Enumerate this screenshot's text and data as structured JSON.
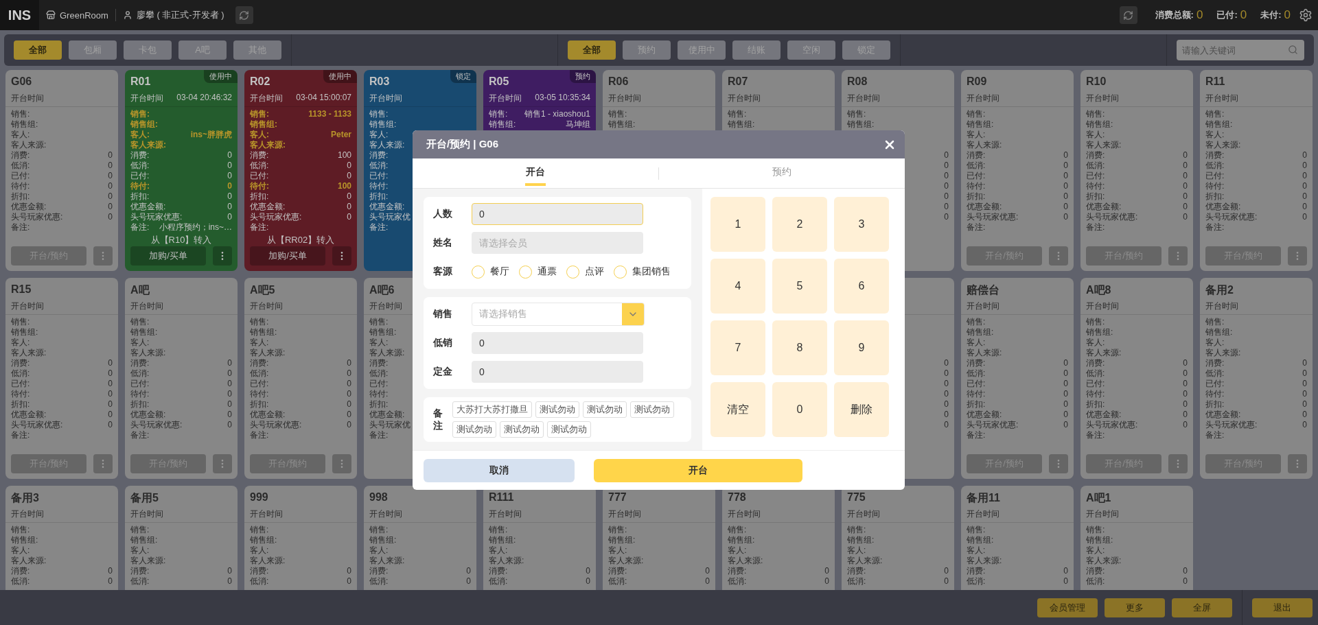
{
  "top_bar": {
    "logo": "INS",
    "store": "GreenRoom",
    "user": "廖攀 ( 非正式-开发者 )",
    "summary": [
      {
        "label": "消费总额:",
        "value": "0"
      },
      {
        "label": "已付:",
        "value": "0"
      },
      {
        "label": "未付:",
        "value": "0"
      }
    ]
  },
  "area_filters": [
    {
      "label": "全部",
      "selected": true
    },
    {
      "label": "包厢",
      "selected": false
    },
    {
      "label": "卡包",
      "selected": false
    },
    {
      "label": "A吧",
      "selected": false
    },
    {
      "label": "其他",
      "selected": false
    }
  ],
  "status_filters": [
    {
      "label": "全部",
      "selected": true
    },
    {
      "label": "预约",
      "selected": false
    },
    {
      "label": "使用中",
      "selected": false
    },
    {
      "label": "结账",
      "selected": false
    },
    {
      "label": "空闲",
      "selected": false
    },
    {
      "label": "锁定",
      "selected": false
    }
  ],
  "search": {
    "placeholder": "请输入关键词"
  },
  "card_rows": [
    {
      "cards": [
        {
          "name": "G06",
          "color": "#878787",
          "open_label": "开台时间",
          "rows": [
            {
              "label": "销售:"
            },
            {
              "label": "销售组:"
            },
            {
              "label": "客人:"
            },
            {
              "label": "客人来源:"
            },
            {
              "label": "消费:",
              "value": "0"
            },
            {
              "label": "低消:",
              "value": "0"
            },
            {
              "label": "已付:",
              "value": "0"
            },
            {
              "label": "待付:",
              "value": "0"
            },
            {
              "label": "折扣:",
              "value": "0"
            },
            {
              "label": "优惠金额:",
              "value": "0"
            },
            {
              "label": "头号玩家优惠:",
              "value": "0"
            },
            {
              "label": "备注:"
            }
          ],
          "action": "开台/预约"
        },
        {
          "name": "R01",
          "badge": "使用中",
          "color": "#245c2d",
          "open_label": "开台时间",
          "open_time": "03-04 20:46:32",
          "rows": [
            {
              "label": "销售:",
              "highlight": true
            },
            {
              "label": "销售组:",
              "highlight": true
            },
            {
              "label": "客人:",
              "value": "ins~胖胖虎",
              "highlight": true
            },
            {
              "label": "客人来源:",
              "highlight": true
            },
            {
              "label": "消费:",
              "value": "0",
              "highlight": false
            },
            {
              "label": "低消:",
              "value": "0",
              "highlight": false
            },
            {
              "label": "已付:",
              "value": "0",
              "highlight": false
            },
            {
              "label": "待付:",
              "value": "0",
              "highlight": true
            },
            {
              "label": "折扣:",
              "value": "0",
              "highlight": false
            },
            {
              "label": "优惠金额:",
              "value": "0",
              "highlight": false
            },
            {
              "label": "头号玩家优惠:",
              "value": "0",
              "highlight": false
            },
            {
              "label": "备注:",
              "value": "小程序预约；ins~…",
              "highlight": false
            }
          ],
          "transfer": "从【R10】转入",
          "action": "加购/买单"
        },
        {
          "name": "R02",
          "badge": "使用中",
          "color": "#5e1c25",
          "open_label": "开台时间",
          "open_time": "03-04 15:00:07",
          "rows": [
            {
              "label": "销售:",
              "value": "1133 - 1133",
              "highlight": true
            },
            {
              "label": "销售组:",
              "highlight": true
            },
            {
              "label": "客人:",
              "value": "Peter",
              "highlight": true
            },
            {
              "label": "客人来源:",
              "highlight": true
            },
            {
              "label": "消费:",
              "value": "100",
              "highlight": false
            },
            {
              "label": "低消:",
              "value": "0",
              "highlight": false
            },
            {
              "label": "已付:",
              "value": "0",
              "highlight": false
            },
            {
              "label": "待付:",
              "value": "100",
              "highlight": true
            },
            {
              "label": "折扣:",
              "value": "0",
              "highlight": false
            },
            {
              "label": "优惠金额:",
              "value": "0",
              "highlight": false
            },
            {
              "label": "头号玩家优惠:",
              "value": "0",
              "highlight": false
            },
            {
              "label": "备注:",
              "highlight": false
            }
          ],
          "transfer": "从【RR02】转入",
          "action": "加购/买单"
        },
        {
          "name": "R03",
          "badge": "锁定",
          "color": "#184a70",
          "open_label": "开台时间",
          "rows": [
            {
              "label": "销售:"
            },
            {
              "label": "销售组:"
            },
            {
              "label": "客人:"
            },
            {
              "label": "客人来源:"
            },
            {
              "label": "消费:"
            },
            {
              "label": "低消:"
            },
            {
              "label": "已付:"
            },
            {
              "label": "待付:"
            },
            {
              "label": "折扣:"
            },
            {
              "label": "优惠金额:"
            },
            {
              "label": "头号玩家优"
            },
            {
              "label": "备注:"
            }
          ]
        },
        {
          "name": "R05",
          "badge": "预约",
          "color": "#3f1d62",
          "open_label": "开台时间",
          "open_time": "03-05 10:35:34",
          "rows": [
            {
              "label": "销售:",
              "value": "销售1 - xiaoshou1"
            },
            {
              "label": "销售组:",
              "value": "马坤组"
            }
          ]
        },
        {
          "name": "R06",
          "color": "#878787",
          "open_label": "开台时间",
          "rows": [
            {
              "label": "销售:"
            },
            {
              "label": "销售组:"
            }
          ]
        },
        {
          "name": "R07",
          "color": "#878787",
          "open_label": "开台时间",
          "rows": [
            {
              "label": "销售:"
            },
            {
              "label": "销售组:"
            }
          ]
        },
        {
          "name": "R08",
          "color": "#878787",
          "open_label": "开台时间",
          "rows": [
            {
              "label": "销售:"
            },
            {
              "label": "销售组:"
            },
            {},
            {},
            {
              "value": "0"
            },
            {
              "value": "0"
            },
            {
              "value": "0"
            },
            {
              "value": "0"
            },
            {
              "value": "0"
            },
            {
              "value": "0"
            },
            {
              "value": "0"
            },
            {}
          ]
        },
        {
          "name": "R09",
          "color": "#878787",
          "open_label": "开台时间",
          "rows": [
            {
              "label": "销售:"
            },
            {
              "label": "销售组:"
            },
            {
              "label": "客人:"
            },
            {
              "label": "客人来源:"
            },
            {
              "label": "消费:",
              "value": "0"
            },
            {
              "label": "低消:",
              "value": "0"
            },
            {
              "label": "已付:",
              "value": "0"
            },
            {
              "label": "待付:",
              "value": "0"
            },
            {
              "label": "折扣:",
              "value": "0"
            },
            {
              "label": "优惠金额:",
              "value": "0"
            },
            {
              "label": "头号玩家优惠:",
              "value": "0"
            },
            {
              "label": "备注:"
            }
          ],
          "action": "开台/预约"
        },
        {
          "name": "R10",
          "color": "#878787",
          "open_label": "开台时间",
          "rows": [
            {
              "label": "销售:"
            },
            {
              "label": "销售组:"
            },
            {
              "label": "客人:"
            },
            {
              "label": "客人来源:"
            },
            {
              "label": "消费:",
              "value": "0"
            },
            {
              "label": "低消:",
              "value": "0"
            },
            {
              "label": "已付:",
              "value": "0"
            },
            {
              "label": "待付:",
              "value": "0"
            },
            {
              "label": "折扣:",
              "value": "0"
            },
            {
              "label": "优惠金额:",
              "value": "0"
            },
            {
              "label": "头号玩家优惠:",
              "value": "0"
            },
            {
              "label": "备注:"
            }
          ],
          "action": "开台/预约"
        },
        {
          "name": "R11",
          "color": "#878787",
          "open_label": "开台时间",
          "rows": [
            {
              "label": "销售:"
            },
            {
              "label": "销售组:"
            },
            {
              "label": "客人:"
            },
            {
              "label": "客人来源:"
            },
            {
              "label": "消费:",
              "value": "0"
            },
            {
              "label": "低消:",
              "value": "0"
            },
            {
              "label": "已付:",
              "value": "0"
            },
            {
              "label": "待付:",
              "value": "0"
            },
            {
              "label": "折扣:",
              "value": "0"
            },
            {
              "label": "优惠金额:",
              "value": "0"
            },
            {
              "label": "头号玩家优惠:",
              "value": "0"
            },
            {
              "label": "备注:"
            }
          ],
          "action": "开台/预约"
        }
      ]
    },
    {
      "cards": [
        {
          "name": "R15",
          "color": "#878787",
          "open_label": "开台时间",
          "rows": [
            {
              "label": "销售:"
            },
            {
              "label": "销售组:"
            },
            {
              "label": "客人:"
            },
            {
              "label": "客人来源:"
            },
            {
              "label": "消费:",
              "value": "0"
            },
            {
              "label": "低消:",
              "value": "0"
            },
            {
              "label": "已付:",
              "value": "0"
            },
            {
              "label": "待付:",
              "value": "0"
            },
            {
              "label": "折扣:",
              "value": "0"
            },
            {
              "label": "优惠金额:",
              "value": "0"
            },
            {
              "label": "头号玩家优惠:",
              "value": "0"
            },
            {
              "label": "备注:"
            }
          ],
          "action": "开台/预约"
        },
        {
          "name": "A吧",
          "color": "#878787",
          "open_label": "开台时间",
          "rows": [
            {
              "label": "销售:"
            },
            {
              "label": "销售组:"
            },
            {
              "label": "客人:"
            },
            {
              "label": "客人来源:"
            },
            {
              "label": "消费:",
              "value": "0"
            },
            {
              "label": "低消:",
              "value": "0"
            },
            {
              "label": "已付:",
              "value": "0"
            },
            {
              "label": "待付:",
              "value": "0"
            },
            {
              "label": "折扣:",
              "value": "0"
            },
            {
              "label": "优惠金额:",
              "value": "0"
            },
            {
              "label": "头号玩家优惠:",
              "value": "0"
            },
            {
              "label": "备注:"
            }
          ],
          "action": "开台/预约"
        },
        {
          "name": "A吧5",
          "color": "#878787",
          "open_label": "开台时间",
          "rows": [
            {
              "label": "销售:"
            },
            {
              "label": "销售组:"
            },
            {
              "label": "客人:"
            },
            {
              "label": "客人来源:"
            },
            {
              "label": "消费:",
              "value": "0"
            },
            {
              "label": "低消:",
              "value": "0"
            },
            {
              "label": "已付:",
              "value": "0"
            },
            {
              "label": "待付:",
              "value": "0"
            },
            {
              "label": "折扣:",
              "value": "0"
            },
            {
              "label": "优惠金额:",
              "value": "0"
            },
            {
              "label": "头号玩家优惠:",
              "value": "0"
            },
            {
              "label": "备注:"
            }
          ],
          "action": "开台/预约"
        },
        {
          "name": "A吧6",
          "color": "#878787",
          "open_label": "开台时间",
          "rows": [
            {
              "label": "销售:"
            },
            {
              "label": "销售组:"
            },
            {
              "label": "客人:"
            },
            {
              "label": "客人来源:"
            },
            {
              "label": "消费:"
            },
            {
              "label": "低消:"
            },
            {
              "label": "已付:"
            },
            {
              "label": "待付:"
            },
            {
              "label": "折扣:"
            },
            {
              "label": "优惠金额:"
            },
            {
              "label": "头号玩家优"
            },
            {
              "label": "备注:"
            }
          ]
        }
      ],
      "right": [
        {
          "rows": [
            {},
            {},
            {},
            {},
            {
              "value": "0"
            },
            {
              "value": "0"
            },
            {
              "value": "0"
            },
            {
              "value": "0"
            },
            {
              "value": "0"
            },
            {
              "value": "0"
            },
            {
              "value": "0"
            },
            {}
          ]
        },
        {
          "name": "赔偿台",
          "color": "#878787",
          "open_label": "开台时间",
          "rows": [
            {
              "label": "销售:"
            },
            {
              "label": "销售组:"
            },
            {
              "label": "客人:"
            },
            {
              "label": "客人来源:"
            },
            {
              "label": "消费:",
              "value": "0"
            },
            {
              "label": "低消:",
              "value": "0"
            },
            {
              "label": "已付:",
              "value": "0"
            },
            {
              "label": "待付:",
              "value": "0"
            },
            {
              "label": "折扣:",
              "value": "0"
            },
            {
              "label": "优惠金额:",
              "value": "0"
            },
            {
              "label": "头号玩家优惠:",
              "value": "0"
            },
            {
              "label": "备注:"
            }
          ],
          "action": "开台/预约"
        },
        {
          "name": "A吧8",
          "color": "#878787",
          "open_label": "开台时间",
          "rows": [
            {
              "label": "销售:"
            },
            {
              "label": "销售组:"
            },
            {
              "label": "客人:"
            },
            {
              "label": "客人来源:"
            },
            {
              "label": "消费:",
              "value": "0"
            },
            {
              "label": "低消:",
              "value": "0"
            },
            {
              "label": "已付:",
              "value": "0"
            },
            {
              "label": "待付:",
              "value": "0"
            },
            {
              "label": "折扣:",
              "value": "0"
            },
            {
              "label": "优惠金额:",
              "value": "0"
            },
            {
              "label": "头号玩家优惠:",
              "value": "0"
            },
            {
              "label": "备注:"
            }
          ],
          "action": "开台/预约"
        },
        {
          "name": "备用2",
          "color": "#878787",
          "open_label": "开台时间",
          "rows": [
            {
              "label": "销售:"
            },
            {
              "label": "销售组:"
            },
            {
              "label": "客人:"
            },
            {
              "label": "客人来源:"
            },
            {
              "label": "消费:",
              "value": "0"
            },
            {
              "label": "低消:",
              "value": "0"
            },
            {
              "label": "已付:",
              "value": "0"
            },
            {
              "label": "待付:",
              "value": "0"
            },
            {
              "label": "折扣:",
              "value": "0"
            },
            {
              "label": "优惠金额:",
              "value": "0"
            },
            {
              "label": "头号玩家优惠:",
              "value": "0"
            },
            {
              "label": "备注:"
            }
          ],
          "action": "开台/预约"
        }
      ]
    },
    {
      "cards": [
        {
          "name": "备用3",
          "color": "#878787",
          "open_label": "开台时间",
          "rows": [
            {
              "label": "销售:"
            },
            {
              "label": "销售组:"
            },
            {
              "label": "客人:"
            },
            {
              "label": "客人来源:"
            },
            {
              "label": "消费:",
              "value": "0"
            },
            {
              "label": "低消:",
              "value": "0"
            }
          ]
        },
        {
          "name": "备用5",
          "color": "#878787",
          "open_label": "开台时间",
          "rows": [
            {
              "label": "销售:"
            },
            {
              "label": "销售组:"
            },
            {
              "label": "客人:"
            },
            {
              "label": "客人来源:"
            },
            {
              "label": "消费:",
              "value": "0"
            },
            {
              "label": "低消:",
              "value": "0"
            }
          ]
        },
        {
          "name": "999",
          "color": "#878787",
          "open_label": "开台时间",
          "rows": [
            {
              "label": "销售:"
            },
            {
              "label": "销售组:"
            },
            {
              "label": "客人:"
            },
            {
              "label": "客人来源:"
            },
            {
              "label": "消费:",
              "value": "0"
            },
            {
              "label": "低消:",
              "value": "0"
            }
          ]
        },
        {
          "name": "998",
          "color": "#878787",
          "open_label": "开台时间",
          "rows": [
            {
              "label": "销售:"
            },
            {
              "label": "销售组:"
            },
            {
              "label": "客人:"
            },
            {
              "label": "客人来源:"
            },
            {
              "label": "消费:",
              "value": "0"
            },
            {
              "label": "低消:",
              "value": "0"
            }
          ]
        },
        {
          "name": "R111",
          "color": "#878787",
          "open_label": "开台时间",
          "rows": [
            {
              "label": "销售:"
            },
            {
              "label": "销售组:"
            },
            {
              "label": "客人:"
            },
            {
              "label": "客人来源:"
            },
            {
              "label": "消费:",
              "value": "0"
            },
            {
              "label": "低消:",
              "value": "0"
            }
          ]
        },
        {
          "name": "777",
          "color": "#878787",
          "open_label": "开台时间",
          "rows": [
            {
              "label": "销售:"
            },
            {
              "label": "销售组:"
            },
            {
              "label": "客人:"
            },
            {
              "label": "客人来源:"
            },
            {
              "label": "消费:",
              "value": "0"
            },
            {
              "label": "低消:",
              "value": "0"
            }
          ]
        },
        {
          "name": "778",
          "color": "#878787",
          "open_label": "开台时间",
          "rows": [
            {
              "label": "销售:"
            },
            {
              "label": "销售组:"
            },
            {
              "label": "客人:"
            },
            {
              "label": "客人来源:"
            },
            {
              "label": "消费:",
              "value": "0"
            },
            {
              "label": "低消:",
              "value": "0"
            }
          ]
        },
        {
          "name": "775",
          "color": "#878787",
          "open_label": "开台时间",
          "rows": [
            {
              "label": "销售:"
            },
            {
              "label": "销售组:"
            },
            {
              "label": "客人:"
            },
            {
              "label": "客人来源:"
            },
            {
              "label": "消费:",
              "value": "0"
            },
            {
              "label": "低消:",
              "value": "0"
            }
          ]
        },
        {
          "name": "备用11",
          "color": "#878787",
          "open_label": "开台时间",
          "rows": [
            {
              "label": "销售:"
            },
            {
              "label": "销售组:"
            },
            {
              "label": "客人:"
            },
            {
              "label": "客人来源:"
            },
            {
              "label": "消费:",
              "value": "0"
            },
            {
              "label": "低消:",
              "value": "0"
            }
          ]
        },
        {
          "name": "A吧1",
          "color": "#878787",
          "open_label": "开台时间",
          "rows": [
            {
              "label": "销售:"
            },
            {
              "label": "销售组:"
            },
            {
              "label": "客人:"
            },
            {
              "label": "客人来源:"
            },
            {
              "label": "消费:",
              "value": "0"
            },
            {
              "label": "低消:",
              "value": "0"
            }
          ]
        }
      ]
    }
  ],
  "modal": {
    "title": "开台/预约 | G06",
    "tabs": [
      {
        "label": "开台",
        "selected": true
      },
      {
        "label": "预约",
        "selected": false
      }
    ],
    "sections": [
      {
        "fields": [
          {
            "kind": "input",
            "label": "人数",
            "value": "0",
            "focused": true
          },
          {
            "kind": "input",
            "label": "姓名",
            "placeholder": "请选择会员",
            "focused": false
          },
          {
            "kind": "radio",
            "label": "客源",
            "options": [
              {
                "label": "餐厅",
                "selected": false
              },
              {
                "label": "通票",
                "selected": false
              },
              {
                "label": "点评",
                "selected": false
              },
              {
                "label": "集团销售",
                "selected": false
              }
            ]
          }
        ]
      },
      {
        "fields": [
          {
            "kind": "select",
            "label": "销售",
            "placeholder": "请选择销售"
          },
          {
            "kind": "input",
            "label": "低销",
            "value": "0",
            "focused": false
          },
          {
            "kind": "input",
            "label": "定金",
            "value": "0",
            "focused": false
          }
        ]
      }
    ],
    "remark": {
      "label": "备注",
      "tags": [
        "大苏打大苏打撒旦",
        "测试勿动",
        "测试勿动",
        "测试勿动",
        "测试勿动",
        "测试勿动",
        "测试勿动"
      ]
    },
    "keypad": [
      "1",
      "2",
      "3",
      "4",
      "5",
      "6",
      "7",
      "8",
      "9",
      "清空",
      "0",
      "删除"
    ],
    "buttons": [
      {
        "label": "取消",
        "kind": "secondary"
      },
      {
        "label": "开台",
        "kind": "primary"
      }
    ]
  },
  "bottom_actions": [
    "会员管理",
    "更多",
    "全屏"
  ],
  "exit": "退出"
}
